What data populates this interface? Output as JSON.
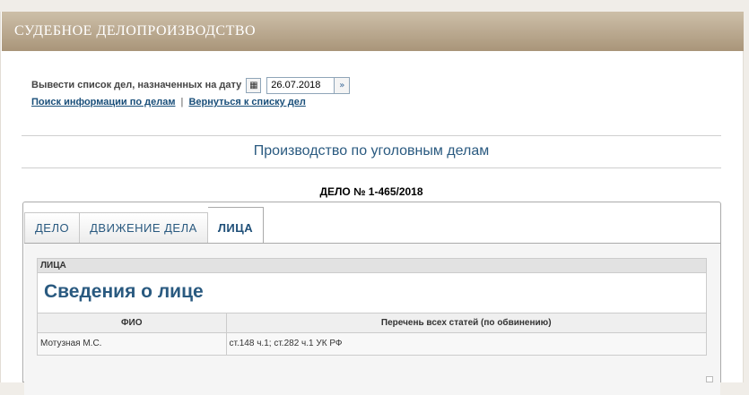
{
  "header": {
    "title": "СУДЕБНОЕ ДЕЛОПРОИЗВОДСТВО"
  },
  "date_filter": {
    "label": "Вывести список дел, назначенных на дату",
    "value": "26.07.2018",
    "calendar_icon": "calendar-icon",
    "go_icon": "double-chevron-right-icon"
  },
  "links": {
    "search": "Поиск информации по делам",
    "separator": "|",
    "back": "Вернуться к списку дел"
  },
  "section_title": "Производство по уголовным делам",
  "case_number": "ДЕЛО № 1-465/2018",
  "tabs": [
    {
      "label": "ДЕЛО",
      "active": false
    },
    {
      "label": "ДВИЖЕНИЕ ДЕЛА",
      "active": false
    },
    {
      "label": "ЛИЦА",
      "active": true
    }
  ],
  "persons_block": {
    "header": "ЛИЦА",
    "title": "Сведения о лице",
    "columns": [
      "ФИО",
      "Перечень всех статей (по обвинению)"
    ],
    "rows": [
      {
        "name": "Мотузная М.С.",
        "articles": "ст.148 ч.1; ст.282 ч.1 УК РФ"
      }
    ]
  },
  "colors": {
    "header_bg": "#b8a68c",
    "accent": "#2a5a80"
  }
}
